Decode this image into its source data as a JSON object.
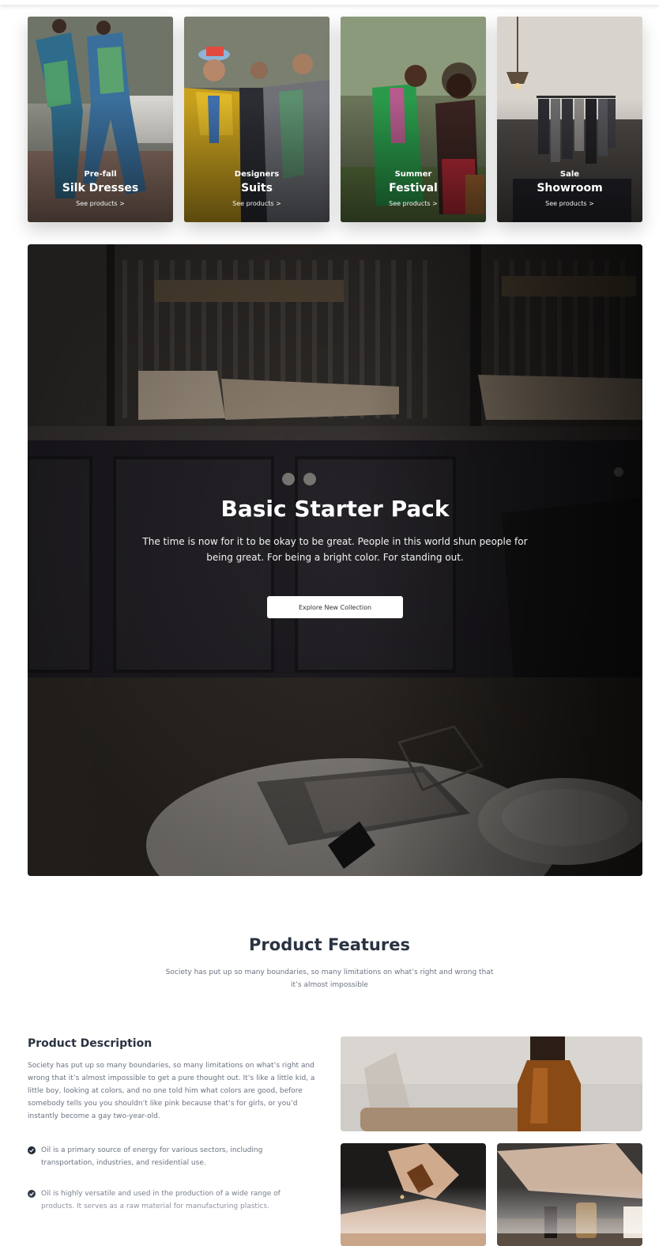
{
  "categories": [
    {
      "kicker": "Pre-fall",
      "title": "Silk Dresses",
      "link": "See products >"
    },
    {
      "kicker": "Designers",
      "title": "Suits",
      "link": "See products >"
    },
    {
      "kicker": "Summer",
      "title": "Festival",
      "link": "See products >"
    },
    {
      "kicker": "Sale",
      "title": "Showroom",
      "link": "See products >"
    }
  ],
  "hero": {
    "title": "Basic Starter Pack",
    "text": "The time is now for it to be okay to be great. People in this world shun people for being great. For being a bright color. For standing out.",
    "button": "Explore New Collection"
  },
  "features": {
    "title": "Product Features",
    "subtitle": "Society has put up so many boundaries, so many limitations on what’s right and wrong that it’s almost impossible"
  },
  "description": {
    "title": "Product Description",
    "body": "Society has put up so many boundaries, so many limitations on what’s right and wrong that it’s almost impossible to get a pure thought out. It’s like a little kid, a little boy, looking at colors, and no one told him what colors are good, before somebody tells you you shouldn’t like pink because that’s for girls, or you’d instantly become a gay two-year-old.",
    "points": [
      "Oil is a primary source of energy for various sectors, including transportation, industries, and residential use.",
      "Oil is highly versatile and used in the production of a wide range of products. It serves as a raw material for manufacturing plastics."
    ]
  },
  "icons": {
    "check": "check-circle-icon"
  }
}
